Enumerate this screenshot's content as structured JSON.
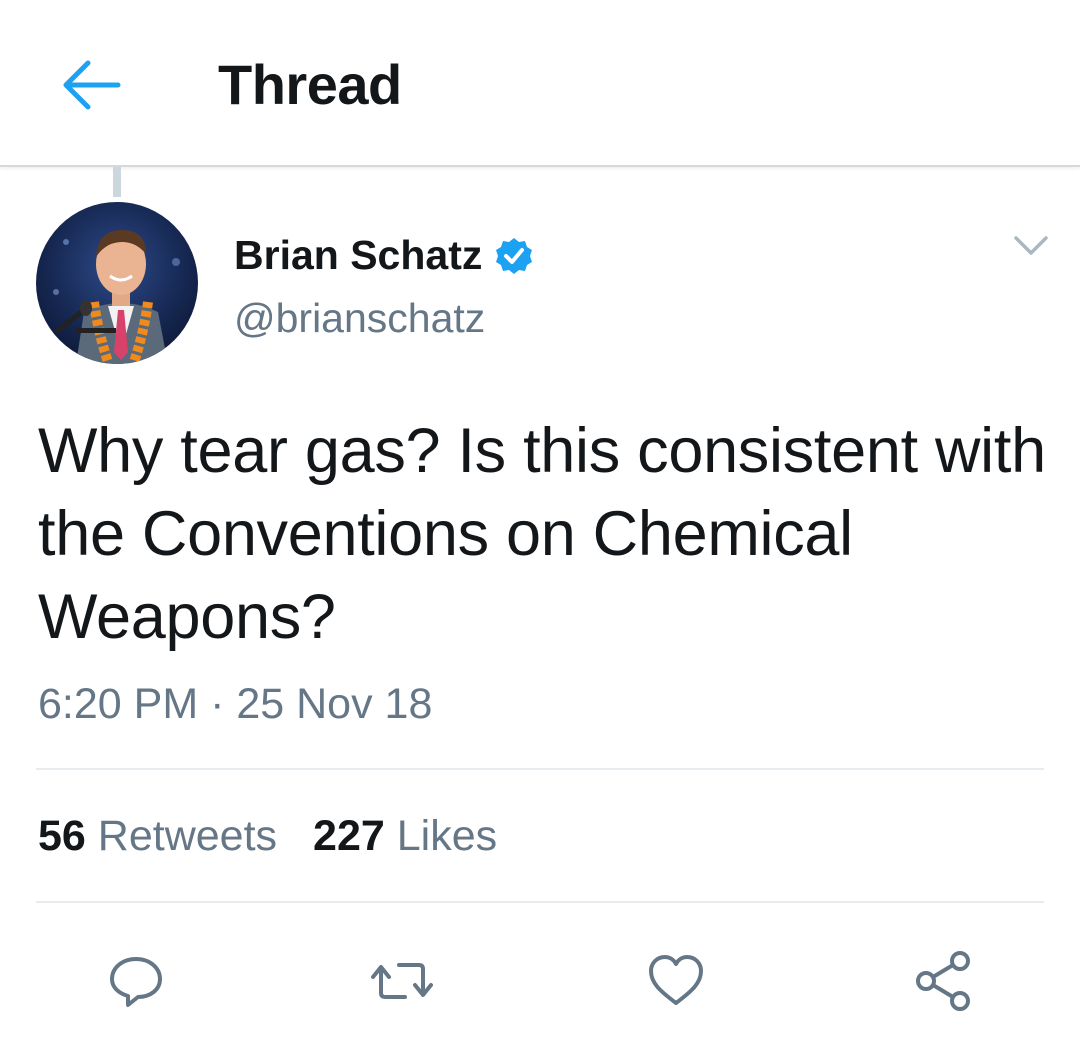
{
  "header": {
    "title": "Thread",
    "back_icon": "arrow-left-icon",
    "accent_color": "#1da1f2"
  },
  "tweet": {
    "author_name": "Brian Schatz",
    "author_handle": "@brianschatz",
    "verified": true,
    "text": "Why tear gas? Is this consistent with the Conventions on Chemical Weapons?",
    "timestamp": "6:20 PM · 25 Nov 18",
    "retweets_count": "56",
    "retweets_label": "Retweets",
    "likes_count": "227",
    "likes_label": "Likes"
  },
  "actions": [
    {
      "icon": "reply-icon"
    },
    {
      "icon": "retweet-icon"
    },
    {
      "icon": "heart-icon"
    },
    {
      "icon": "share-icon"
    }
  ],
  "colors": {
    "text_primary": "#14171a",
    "text_secondary": "#657786",
    "icon_gray": "#657786",
    "verified_blue": "#1da1f2",
    "divider": "#e6ecf0"
  }
}
